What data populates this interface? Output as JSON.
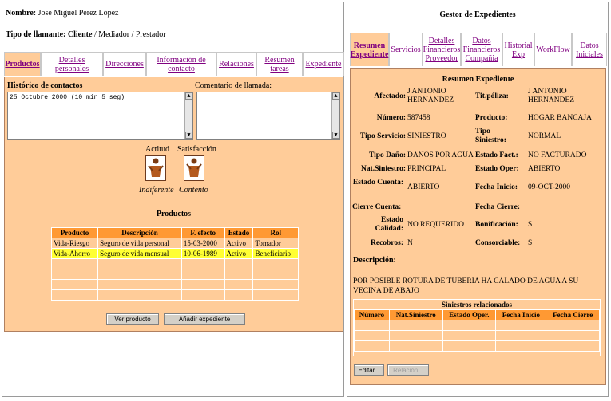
{
  "left": {
    "nombre_label": "Nombre:",
    "nombre_value": "Jose Miguel Pérez López",
    "tipo_label": "Tipo de llamante:",
    "tipo_selected": "Cliente",
    "tipo_rest": " / Mediador / Prestador",
    "tabs": [
      "Productos",
      "Detalles personales",
      "Direcciones",
      "Información de contacto",
      "Relaciones",
      "Resumen tareas",
      "Expediente"
    ],
    "historico_label": "Histórico de contactos",
    "historico_value": "25 Octubre 2000 (10 min 5 seg)",
    "comentario_label": "Comentario de llamada:",
    "actitud_label": "Actitud",
    "satisfaccion_label": "Satisfacción",
    "actitud_value": "Indiferente",
    "satisfaccion_value": "Contento",
    "productos_title": "Productos",
    "products_table": {
      "headers": [
        "Producto",
        "Descripción",
        "F. efecto",
        "Estado",
        "Rol"
      ],
      "rows": [
        [
          "Vida-Riesgo",
          "Seguro de vida personal",
          "15-03-2000",
          "Activo",
          "Tomador"
        ],
        [
          "Vida-Ahorro",
          "Seguro de vida mensual",
          "10-06-1989",
          "Activo",
          "Beneficiario"
        ]
      ]
    },
    "buttons": {
      "ver_producto": "Ver producto",
      "anadir_expediente": "Añadir expediente"
    }
  },
  "right": {
    "title": "Gestor de Expedientes",
    "tabs": [
      "Resumen Expediente",
      "Servicios",
      "Detalles Financieros Proveedor",
      "Datos Financieros Compañia",
      "Historial Exp",
      "WorkFlow",
      "Datos Iniciales"
    ],
    "resumen_title": "Resumen Expediente",
    "fields": {
      "afectado_label": "Afectado:",
      "afectado": "J ANTONIO HERNANDEZ",
      "titpoliza_label": "Tit.póliza:",
      "titpoliza": "J ANTONIO HERNANDEZ",
      "numero_label": "Número:",
      "numero": "587458",
      "producto_label": "Producto:",
      "producto": "HOGAR BANCAJA",
      "tiposervicio_label": "Tipo Servicio:",
      "tiposervicio": "SINIESTRO",
      "tiposiniestro_label": "Tipo Siniestro:",
      "tiposiniestro": "NORMAL",
      "tipodano_label": "Tipo Daño:",
      "tipodano": "DAÑOS POR AGUA",
      "estadofact_label": "Estado Fact.:",
      "estadofact": "NO FACTURADO",
      "natsiniestro_label": "Nat.Siniestro:",
      "natsiniestro": "PRINCIPAL",
      "estadooper_label": "Estado Oper:",
      "estadooper": "ABIERTO",
      "estadocuenta_label": "Estado Cuenta:",
      "estadocuenta": "ABIERTO",
      "fechainicio_label": "Fecha Inicio:",
      "fechainicio": "09-OCT-2000",
      "cierrecuenta_label": "Cierre Cuenta:",
      "cierrecuenta": "",
      "fechacierre_label": "Fecha Cierre:",
      "fechacierre": "",
      "estadocalidad_label": "Estado Calidad:",
      "estadocalidad": "NO REQUERIDO",
      "bonificacion_label": "Bonificación:",
      "bonificacion": "S",
      "recobros_label": "Recobros:",
      "recobros": "N",
      "consorciable_label": "Consorciable:",
      "consorciable": "S"
    },
    "descripcion_label": "Descripción:",
    "descripcion": "POR POSIBLE ROTURA DE TUBERIA HA CALADO DE AGUA A SU VECINA DE ABAJO",
    "siniestros_title": "Siniestros relacionados",
    "siniestros_headers": [
      "Número",
      "Nat.Siniestro",
      "Estado Oper.",
      "Fecha Inicio",
      "Fecha Cierre"
    ],
    "buttons": {
      "editar": "Editar...",
      "relacion": "Relación..."
    }
  }
}
